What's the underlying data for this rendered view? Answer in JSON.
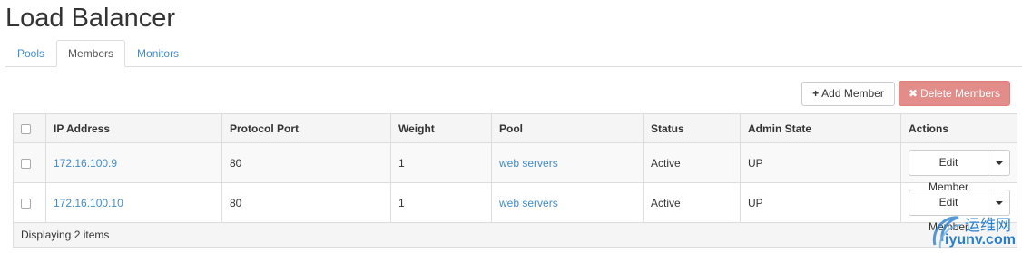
{
  "page": {
    "title": "Load Balancer"
  },
  "tabs": [
    {
      "label": "Pools",
      "active": false
    },
    {
      "label": "Members",
      "active": true
    },
    {
      "label": "Monitors",
      "active": false
    }
  ],
  "toolbar": {
    "add_icon": "+",
    "add_label": "Add Member",
    "delete_icon": "✖",
    "delete_label": "Delete Members"
  },
  "table": {
    "columns": [
      "IP Address",
      "Protocol Port",
      "Weight",
      "Pool",
      "Status",
      "Admin State",
      "Actions"
    ],
    "rows": [
      {
        "ip": "172.16.100.9",
        "port": "80",
        "weight": "1",
        "pool": "web servers",
        "status": "Active",
        "admin_state": "UP",
        "action": "Edit Member"
      },
      {
        "ip": "172.16.100.10",
        "port": "80",
        "weight": "1",
        "pool": "web servers",
        "status": "Active",
        "admin_state": "UP",
        "action": "Edit Member"
      }
    ],
    "footer": "Displaying 2 items"
  },
  "watermark": {
    "line1": "运维网",
    "line2": "iyunv.com"
  },
  "colors": {
    "link": "#428bca",
    "danger": "#e38d8b"
  }
}
